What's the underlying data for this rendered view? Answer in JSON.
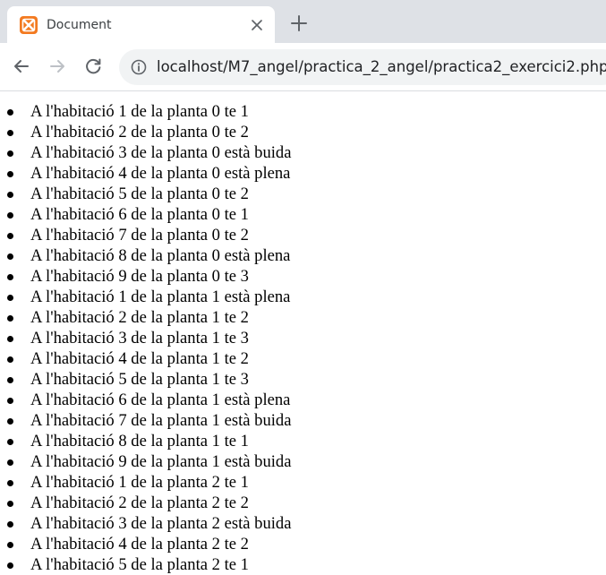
{
  "browser": {
    "tab": {
      "title": "Document",
      "favicon": "xampp-icon"
    },
    "address": "localhost/M7_angel/practica_2_angel/practica2_exercici2.php",
    "icons": [
      "back-icon",
      "forward-icon",
      "reload-icon",
      "info-icon",
      "close-icon",
      "plus-icon"
    ],
    "colors": {
      "tabstrip": "#dee1e6",
      "omnibox": "#f1f3f4",
      "favicon": "#f37a20",
      "text": "#3c4043"
    }
  },
  "page": {
    "items": [
      "A l'habitació 1 de la planta 0 te 1",
      "A l'habitació 2 de la planta 0 te 2",
      "A l'habitació 3 de la planta 0 està buida",
      "A l'habitació 4 de la planta 0 està plena",
      "A l'habitació 5 de la planta 0 te 2",
      "A l'habitació 6 de la planta 0 te 1",
      "A l'habitació 7 de la planta 0 te 2",
      "A l'habitació 8 de la planta 0 està plena",
      "A l'habitació 9 de la planta 0 te 3",
      "A l'habitació 1 de la planta 1 està plena",
      "A l'habitació 2 de la planta 1 te 2",
      "A l'habitació 3 de la planta 1 te 3",
      "A l'habitació 4 de la planta 1 te 2",
      "A l'habitació 5 de la planta 1 te 3",
      "A l'habitació 6 de la planta 1 està plena",
      "A l'habitació 7 de la planta 1 està buida",
      "A l'habitació 8 de la planta 1 te 1",
      "A l'habitació 9 de la planta 1 està buida",
      "A l'habitació 1 de la planta 2 te 1",
      "A l'habitació 2 de la planta 2 te 2",
      "A l'habitació 3 de la planta 2 està buida",
      "A l'habitació 4 de la planta 2 te 2",
      "A l'habitació 5 de la planta 2 te 1"
    ]
  }
}
